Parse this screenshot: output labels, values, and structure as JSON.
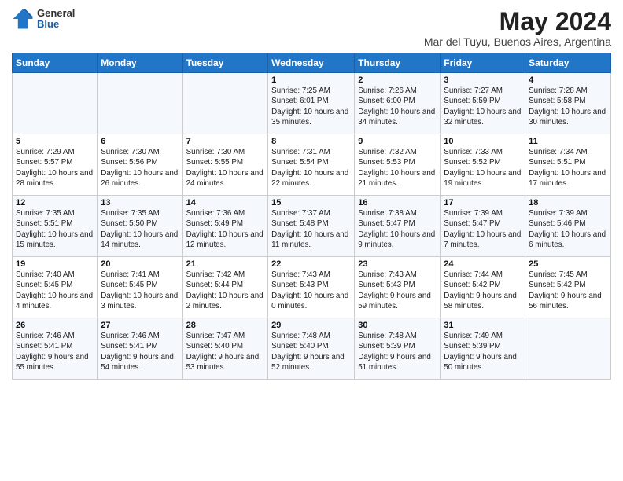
{
  "logo": {
    "line1": "General",
    "line2": "Blue"
  },
  "title": "May 2024",
  "subtitle": "Mar del Tuyu, Buenos Aires, Argentina",
  "weekdays": [
    "Sunday",
    "Monday",
    "Tuesday",
    "Wednesday",
    "Thursday",
    "Friday",
    "Saturday"
  ],
  "weeks": [
    [
      null,
      null,
      null,
      {
        "day": 1,
        "sunrise": "7:25 AM",
        "sunset": "6:01 PM",
        "daylight": "10 hours and 35 minutes."
      },
      {
        "day": 2,
        "sunrise": "7:26 AM",
        "sunset": "6:00 PM",
        "daylight": "10 hours and 34 minutes."
      },
      {
        "day": 3,
        "sunrise": "7:27 AM",
        "sunset": "5:59 PM",
        "daylight": "10 hours and 32 minutes."
      },
      {
        "day": 4,
        "sunrise": "7:28 AM",
        "sunset": "5:58 PM",
        "daylight": "10 hours and 30 minutes."
      }
    ],
    [
      {
        "day": 5,
        "sunrise": "7:29 AM",
        "sunset": "5:57 PM",
        "daylight": "10 hours and 28 minutes."
      },
      {
        "day": 6,
        "sunrise": "7:30 AM",
        "sunset": "5:56 PM",
        "daylight": "10 hours and 26 minutes."
      },
      {
        "day": 7,
        "sunrise": "7:30 AM",
        "sunset": "5:55 PM",
        "daylight": "10 hours and 24 minutes."
      },
      {
        "day": 8,
        "sunrise": "7:31 AM",
        "sunset": "5:54 PM",
        "daylight": "10 hours and 22 minutes."
      },
      {
        "day": 9,
        "sunrise": "7:32 AM",
        "sunset": "5:53 PM",
        "daylight": "10 hours and 21 minutes."
      },
      {
        "day": 10,
        "sunrise": "7:33 AM",
        "sunset": "5:52 PM",
        "daylight": "10 hours and 19 minutes."
      },
      {
        "day": 11,
        "sunrise": "7:34 AM",
        "sunset": "5:51 PM",
        "daylight": "10 hours and 17 minutes."
      }
    ],
    [
      {
        "day": 12,
        "sunrise": "7:35 AM",
        "sunset": "5:51 PM",
        "daylight": "10 hours and 15 minutes."
      },
      {
        "day": 13,
        "sunrise": "7:35 AM",
        "sunset": "5:50 PM",
        "daylight": "10 hours and 14 minutes."
      },
      {
        "day": 14,
        "sunrise": "7:36 AM",
        "sunset": "5:49 PM",
        "daylight": "10 hours and 12 minutes."
      },
      {
        "day": 15,
        "sunrise": "7:37 AM",
        "sunset": "5:48 PM",
        "daylight": "10 hours and 11 minutes."
      },
      {
        "day": 16,
        "sunrise": "7:38 AM",
        "sunset": "5:47 PM",
        "daylight": "10 hours and 9 minutes."
      },
      {
        "day": 17,
        "sunrise": "7:39 AM",
        "sunset": "5:47 PM",
        "daylight": "10 hours and 7 minutes."
      },
      {
        "day": 18,
        "sunrise": "7:39 AM",
        "sunset": "5:46 PM",
        "daylight": "10 hours and 6 minutes."
      }
    ],
    [
      {
        "day": 19,
        "sunrise": "7:40 AM",
        "sunset": "5:45 PM",
        "daylight": "10 hours and 4 minutes."
      },
      {
        "day": 20,
        "sunrise": "7:41 AM",
        "sunset": "5:45 PM",
        "daylight": "10 hours and 3 minutes."
      },
      {
        "day": 21,
        "sunrise": "7:42 AM",
        "sunset": "5:44 PM",
        "daylight": "10 hours and 2 minutes."
      },
      {
        "day": 22,
        "sunrise": "7:43 AM",
        "sunset": "5:43 PM",
        "daylight": "10 hours and 0 minutes."
      },
      {
        "day": 23,
        "sunrise": "7:43 AM",
        "sunset": "5:43 PM",
        "daylight": "9 hours and 59 minutes."
      },
      {
        "day": 24,
        "sunrise": "7:44 AM",
        "sunset": "5:42 PM",
        "daylight": "9 hours and 58 minutes."
      },
      {
        "day": 25,
        "sunrise": "7:45 AM",
        "sunset": "5:42 PM",
        "daylight": "9 hours and 56 minutes."
      }
    ],
    [
      {
        "day": 26,
        "sunrise": "7:46 AM",
        "sunset": "5:41 PM",
        "daylight": "9 hours and 55 minutes."
      },
      {
        "day": 27,
        "sunrise": "7:46 AM",
        "sunset": "5:41 PM",
        "daylight": "9 hours and 54 minutes."
      },
      {
        "day": 28,
        "sunrise": "7:47 AM",
        "sunset": "5:40 PM",
        "daylight": "9 hours and 53 minutes."
      },
      {
        "day": 29,
        "sunrise": "7:48 AM",
        "sunset": "5:40 PM",
        "daylight": "9 hours and 52 minutes."
      },
      {
        "day": 30,
        "sunrise": "7:48 AM",
        "sunset": "5:39 PM",
        "daylight": "9 hours and 51 minutes."
      },
      {
        "day": 31,
        "sunrise": "7:49 AM",
        "sunset": "5:39 PM",
        "daylight": "9 hours and 50 minutes."
      },
      null
    ]
  ]
}
